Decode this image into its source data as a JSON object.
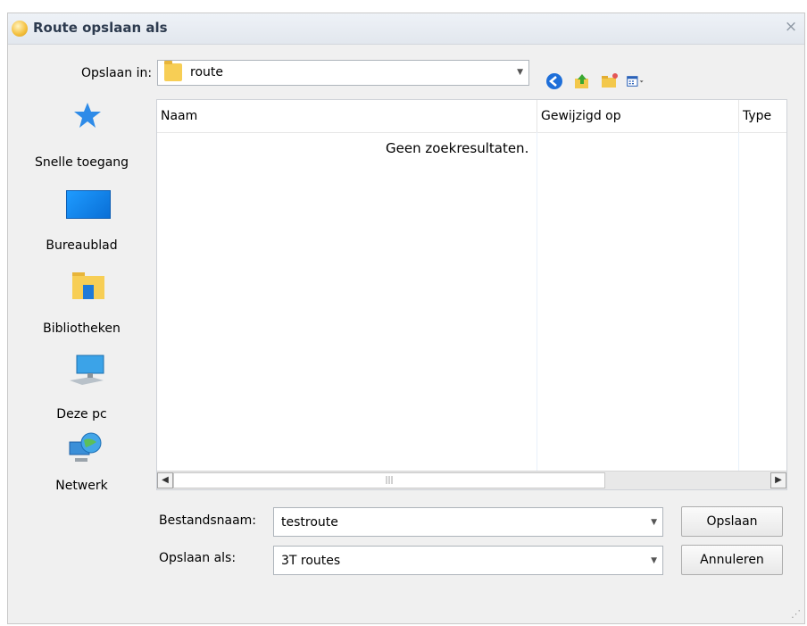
{
  "window": {
    "title": "Route opslaan als",
    "close_glyph": "×"
  },
  "save_in": {
    "label": "Opslaan in:",
    "value": "route"
  },
  "toolbar": {
    "back_icon": "back-arrow-icon",
    "up_icon": "up-folder-icon",
    "new_folder_icon": "new-folder-icon",
    "view_icon": "view-menu-icon"
  },
  "places": [
    {
      "label": "Snelle toegang",
      "icon": "star-icon"
    },
    {
      "label": "Bureaublad",
      "icon": "desktop-icon"
    },
    {
      "label": "Bibliotheken",
      "icon": "libraries-icon"
    },
    {
      "label": "Deze pc",
      "icon": "computer-icon"
    },
    {
      "label": "Netwerk",
      "icon": "network-icon"
    }
  ],
  "list": {
    "columns": [
      "Naam",
      "Gewijzigd op",
      "Type"
    ],
    "empty_text": "Geen zoekresultaten."
  },
  "filename": {
    "label": "Bestandsnaam:",
    "value": "testroute"
  },
  "filetype": {
    "label": "Opslaan als:",
    "value": "3T routes"
  },
  "buttons": {
    "save": "Opslaan",
    "cancel": "Annuleren"
  },
  "colors": {
    "title_text": "#2d3b4f",
    "accent_blue": "#1e88e5",
    "folder_yellow": "#f7ce55"
  }
}
